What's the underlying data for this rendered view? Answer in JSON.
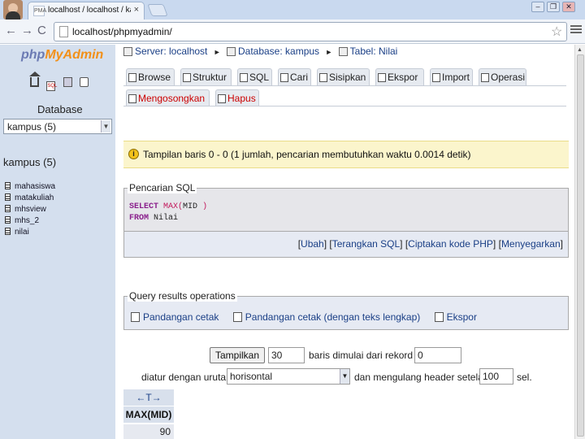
{
  "browser": {
    "tab_title": "localhost / localhost / kampus",
    "tab_favicon": "PMA",
    "tab_close": "×",
    "url": "localhost/phpmyadmin/",
    "back": "←",
    "forward": "→",
    "reload": "C",
    "star": "☆",
    "minimize": "–",
    "restore": "❐",
    "close": "✕"
  },
  "sidebar": {
    "logo_php": "php",
    "logo_my": "MyAdmin",
    "database_label": "Database",
    "database_selected": "kampus (5)",
    "db_title": "kampus (5)",
    "tables": [
      "mahasiswa",
      "matakuliah",
      "mhsview",
      "mhs_2",
      "nilai"
    ]
  },
  "breadcrumb": {
    "server": "Server: localhost",
    "database": "Database: kampus",
    "table": "Tabel: Nilai",
    "sep": "►"
  },
  "tabs_row1": [
    "Browse",
    "Struktur",
    "SQL",
    "Cari",
    "Sisipkan",
    "Ekspor",
    "Import",
    "Operasi"
  ],
  "tabs_row2": [
    "Mengosongkan",
    "Hapus"
  ],
  "notice": {
    "text": "Tampilan baris 0 - 0 (1 jumlah, pencarian membutuhkan waktu 0.0014 detik)",
    "icon": "i"
  },
  "sql_query": {
    "legend": "Pencarian SQL",
    "select_kw": "SELECT",
    "max_fn": "MAX(",
    "column": "MID",
    "close_paren": ")",
    "from_kw": "FROM",
    "table": "Nilai",
    "links": [
      "Ubah",
      "Terangkan SQL",
      "Ciptakan kode PHP",
      "Menyegarkan"
    ],
    "bracket_open": "[",
    "bracket_close": "]"
  },
  "query_ops": {
    "legend": "Query results operations",
    "links": [
      "Pandangan cetak",
      "Pandangan cetak (dengan teks lengkap)",
      "Ekspor"
    ]
  },
  "navigation": {
    "show_button": "Tampilkan",
    "rows_value": "30",
    "rows_label": "baris dimulai dari rekord #",
    "start_value": "0",
    "order_label": "diatur dengan urutan",
    "direction": "horisontal",
    "repeat_label": "dan mengulang header setelah",
    "repeat_value": "100",
    "cells_label": "sel."
  },
  "results": {
    "arrows": "←T→",
    "column_header": "MAX(MID)",
    "value": "90"
  }
}
